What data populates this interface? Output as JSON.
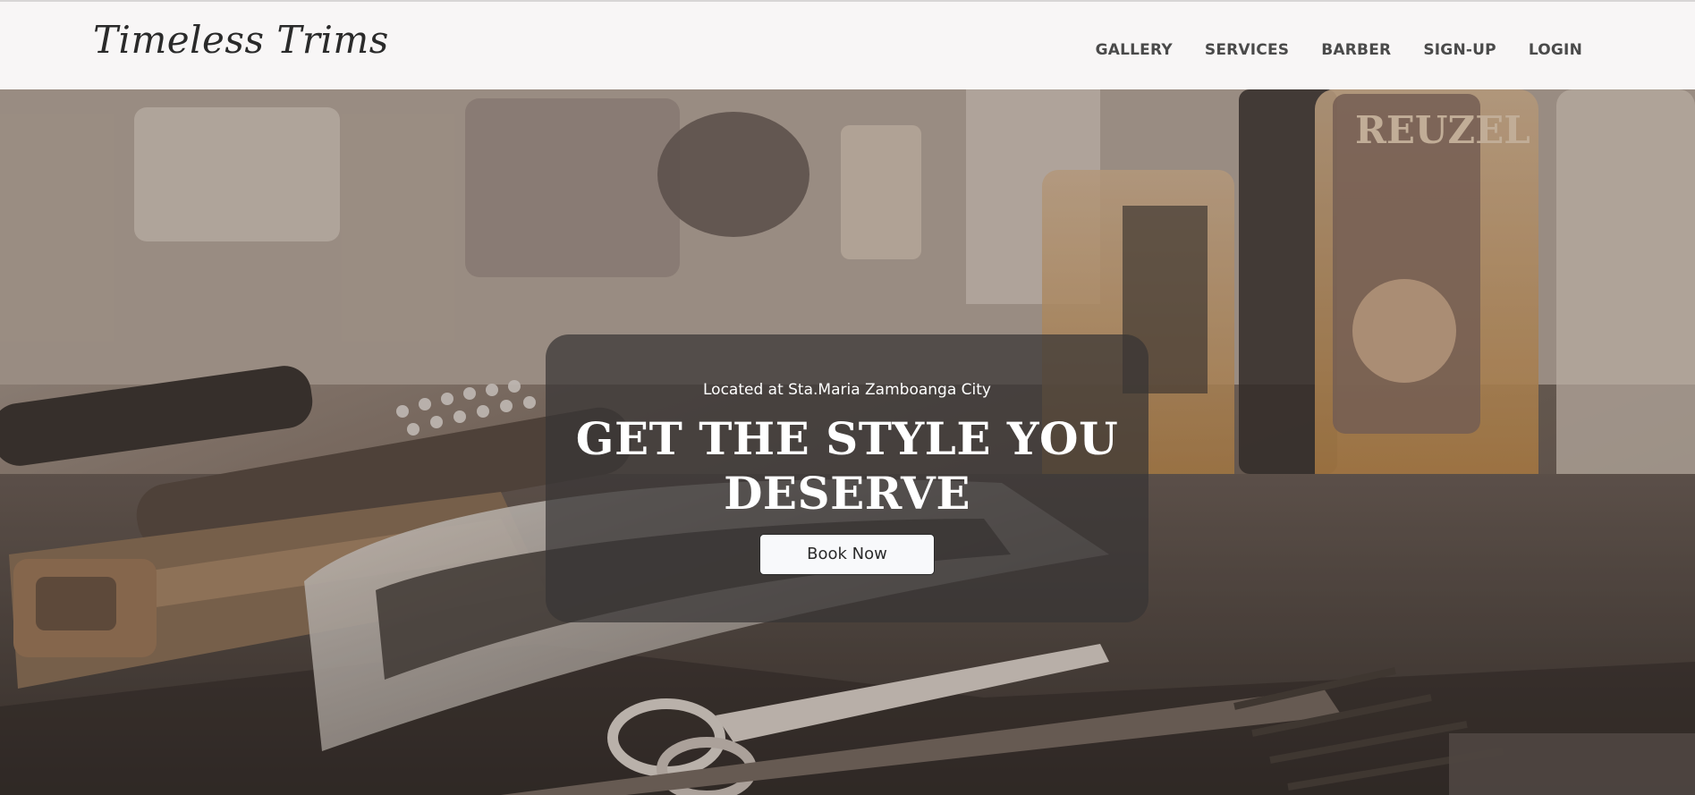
{
  "brand": {
    "name": "Timeless Trims"
  },
  "nav": {
    "items": [
      {
        "label": "GALLERY"
      },
      {
        "label": "SERVICES"
      },
      {
        "label": "BARBER"
      },
      {
        "label": "SIGN-UP"
      },
      {
        "label": "LOGIN"
      }
    ]
  },
  "hero": {
    "location": "Located at Sta.Maria Zamboanga City",
    "headline_line1": "GET THE STYLE YOU",
    "headline_line2": "DESERVE",
    "cta_label": "Book Now"
  },
  "background_labels": {
    "bottle_brand": "REUZEL"
  },
  "colors": {
    "navbar_bg": "#f8f6f6",
    "nav_text": "#4a4a4a",
    "card_bg": "rgba(55,52,52,0.72)",
    "cta_bg": "#f8f9fb"
  }
}
